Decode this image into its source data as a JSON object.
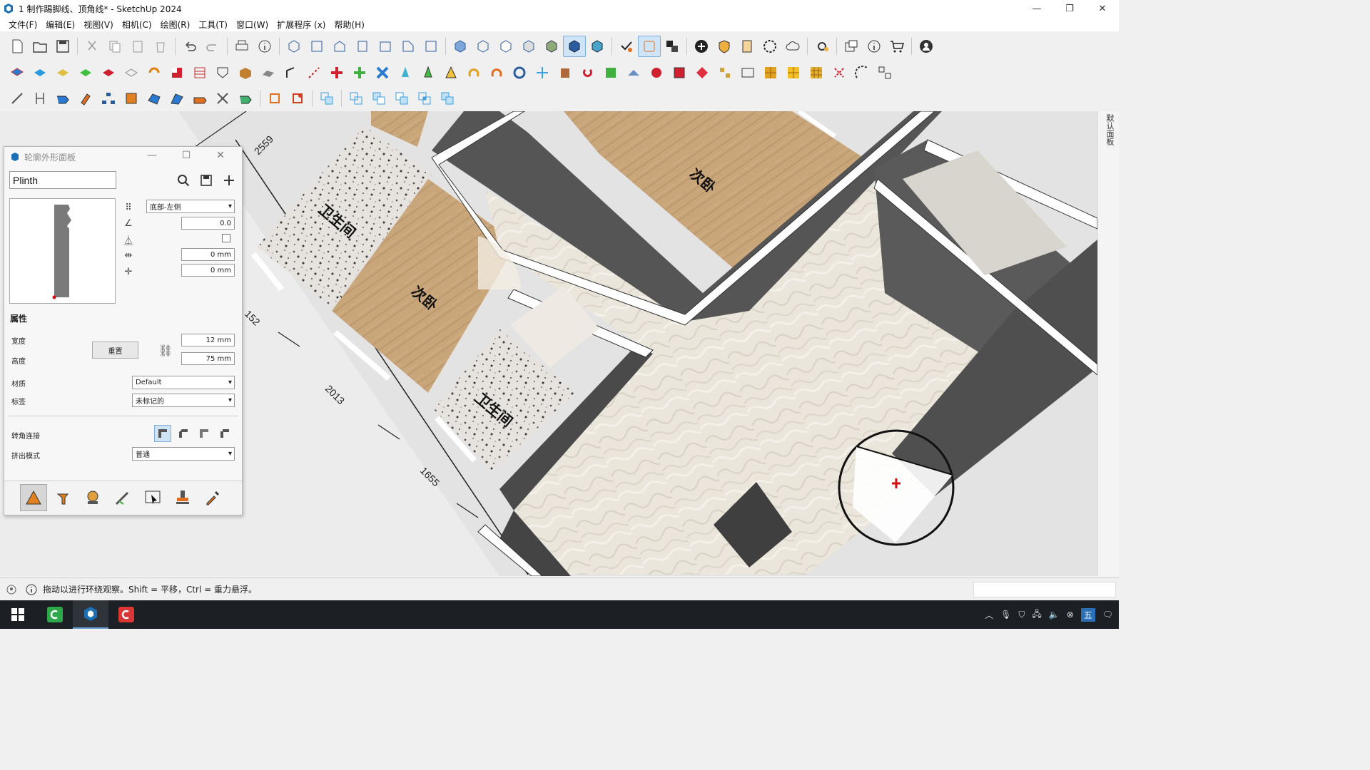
{
  "window": {
    "title": "1 制作踢脚线、顶角线* - SketchUp 2024",
    "controls": [
      "—",
      "❐",
      "✕"
    ]
  },
  "menu": [
    "文件(F)",
    "编辑(E)",
    "视图(V)",
    "相机(C)",
    "绘图(R)",
    "工具(T)",
    "窗口(W)",
    "扩展程序 (x)",
    "帮助(H)"
  ],
  "viewport": {
    "dims": [
      "2559",
      "152",
      "2013",
      "1655"
    ],
    "rooms": [
      "卫生间",
      "次卧",
      "卫生间",
      "次卧"
    ],
    "right_panel_label": "默认面板",
    "colors": {
      "wall_top": "#ffffff",
      "wall_side": "#555555",
      "wood": "#c9a57a",
      "carpet": "#ebe6dc",
      "terrazzo": "#e6e3de"
    }
  },
  "panel": {
    "title": "轮廓外形面板",
    "search_value": "Plinth",
    "align_select": "底部-左侧",
    "angle": "0.0",
    "offset_x": "0 mm",
    "offset_y": "0 mm",
    "section_props": "属性",
    "width_label": "宽度",
    "height_label": "高度",
    "reset_button": "重置",
    "width_value": "12 mm",
    "height_value": "75 mm",
    "material_label": "材质",
    "material_value": "Default",
    "tag_label": "标签",
    "tag_value": "未标记的",
    "corner_label": "转角连接",
    "extrude_label": "挤出模式",
    "extrude_value": "普通"
  },
  "status": {
    "message": "拖动以进行环绕观察。Shift = 平移，Ctrl = 重力悬浮。"
  },
  "taskbar": {
    "ime": "五"
  }
}
